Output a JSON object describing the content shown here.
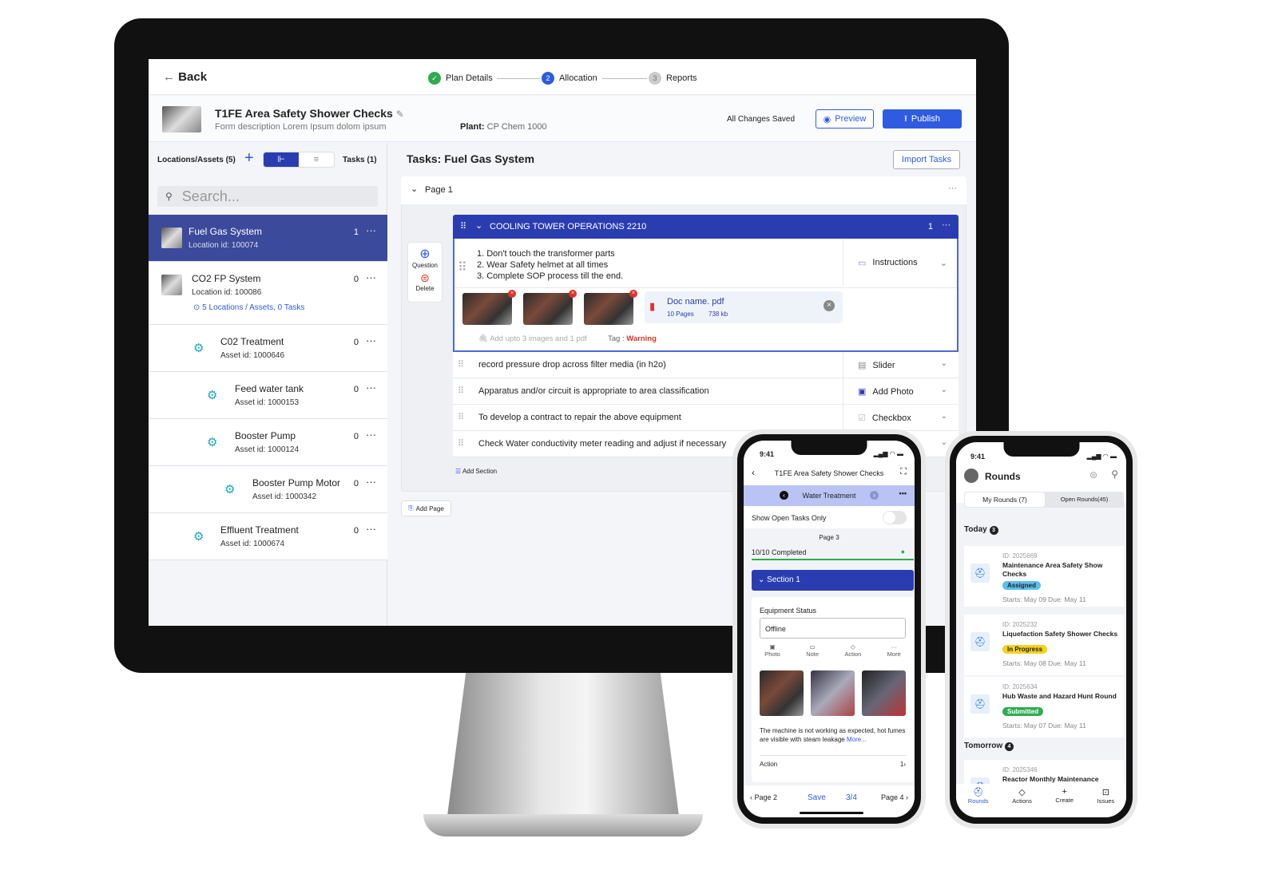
{
  "desktop": {
    "back_label": "Back",
    "steps": [
      {
        "label": "Plan Details",
        "status": "done"
      },
      {
        "number": "2",
        "label": "Allocation",
        "status": "active"
      },
      {
        "number": "3",
        "label": "Reports",
        "status": "pending"
      }
    ],
    "form": {
      "title": "T1FE Area Safety Shower Checks",
      "description": "Form description Lorem Ipsum dolom ipsum",
      "plant_label": "Plant:",
      "plant_value": "CP Chem 1000",
      "save_status": "All Changes Saved",
      "preview_label": "Preview",
      "publish_label": "Publish"
    },
    "left": {
      "locations_label": "Locations/Assets (5)",
      "tasks_label": "Tasks (1)",
      "search_placeholder": "Search...",
      "items": [
        {
          "name": "Fuel Gas System",
          "sub": "Location id: 100074",
          "count": "1",
          "selected": true
        },
        {
          "name": "CO2 FP System",
          "sub": "Location id: 100086",
          "count": "0",
          "link": "5 Locations / Assets, 0 Tasks"
        },
        {
          "name": "C02 Treatment",
          "sub": "Asset id: 1000646",
          "count": "0"
        },
        {
          "name": "Feed water tank",
          "sub": "Asset id: 1000153",
          "count": "0"
        },
        {
          "name": "Booster Pump",
          "sub": "Asset id: 1000124",
          "count": "0"
        },
        {
          "name": "Booster Pump Motor",
          "sub": "Asset id: 1000342",
          "count": "0"
        },
        {
          "name": "Effluent Treatment",
          "sub": "Asset id: 1000674",
          "count": "0"
        }
      ]
    },
    "main": {
      "title": "Tasks: Fuel Gas System",
      "import_label": "Import Tasks",
      "page_label": "Page 1",
      "section_title": "COOLING TOWER OPERATIONS 2210",
      "section_count": "1",
      "question_label": "Question",
      "delete_label": "Delete",
      "instructions": [
        "1. Don't touch the transformer parts",
        "2. Wear Safety helmet at all times",
        "3. Complete SOP process till the end."
      ],
      "instructions_type": "Instructions",
      "doc_name": "Doc name. pdf",
      "doc_pages": "10 Pages",
      "doc_size": "738 kb",
      "attach_hint": "Add upto 3 images and 1 pdf",
      "tag_label": "Tag :",
      "tag_value": "Warning",
      "tasks": [
        {
          "text": "record pressure drop across filter media (in h2o)",
          "type": "Slider"
        },
        {
          "text": "Apparatus and/or circuit is appropriate to area classification",
          "type": "Add Photo"
        },
        {
          "text": "To develop a contract to repair the above equipment",
          "type": "Checkbox"
        },
        {
          "text": "Check Water conductivity meter reading and adjust if necessary",
          "type": ""
        }
      ],
      "add_section_label": "Add Section",
      "add_page_label": "Add Page"
    }
  },
  "phone1": {
    "time": "9:41",
    "title": "T1FE Area Safety Shower Checks",
    "subheader": "Water Treatment",
    "toggle_label": "Show Open Tasks Only",
    "page_label": "Page 3",
    "progress_label": "10/10 Completed",
    "progress": 1.0,
    "section_label": "Section 1",
    "field_label": "Equipment Status",
    "field_value": "Offline",
    "actions": [
      "Photo",
      "Note",
      "Action",
      "More"
    ],
    "note_text": "The machine is not working  as expected, hot fumes are visible with steam leakage",
    "more_link": "More...",
    "action_label": "Action",
    "action_count": "1",
    "footer": {
      "prev": "Page 2",
      "save": "Save",
      "position": "3/4",
      "next": "Page 4"
    }
  },
  "phone2": {
    "time": "9:41",
    "title": "Rounds",
    "tabs": [
      "My Rounds (7)",
      "Open Rounds(45)"
    ],
    "today_label": "Today",
    "today_count": "3",
    "tomorrow_label": "Tomorrow",
    "tomorrow_count": "4",
    "rounds": [
      {
        "id": "ID: 2025669",
        "name": "Maintenance Area Safety Show Checks",
        "status": "Assigned",
        "status_color": "#5bc0f0",
        "dates": "Starts:  May 09     Due:  May 11"
      },
      {
        "id": "ID: 2025232",
        "name": "Liquefaction Safety Shower Checks",
        "status": "In Progress",
        "status_color": "#f5d21e",
        "dates": "Starts:  May 08     Due:  May 11"
      },
      {
        "id": "ID: 2025634",
        "name": "Hub Waste and Hazard Hunt Round",
        "status": "Submitted",
        "status_color": "#2eab4f",
        "dates": "Starts:  May 07     Due:  May 11"
      },
      {
        "id": "ID: 2025346",
        "name": "Reactor Monthly Maintenance"
      }
    ],
    "nav": [
      "Rounds",
      "Actions",
      "Create",
      "Issues"
    ]
  },
  "colors": {
    "primary": "#2f5be0",
    "section": "#2a3db0",
    "selected": "#3b4a9a",
    "warning": "#e0332a",
    "success": "#2eab4f"
  }
}
